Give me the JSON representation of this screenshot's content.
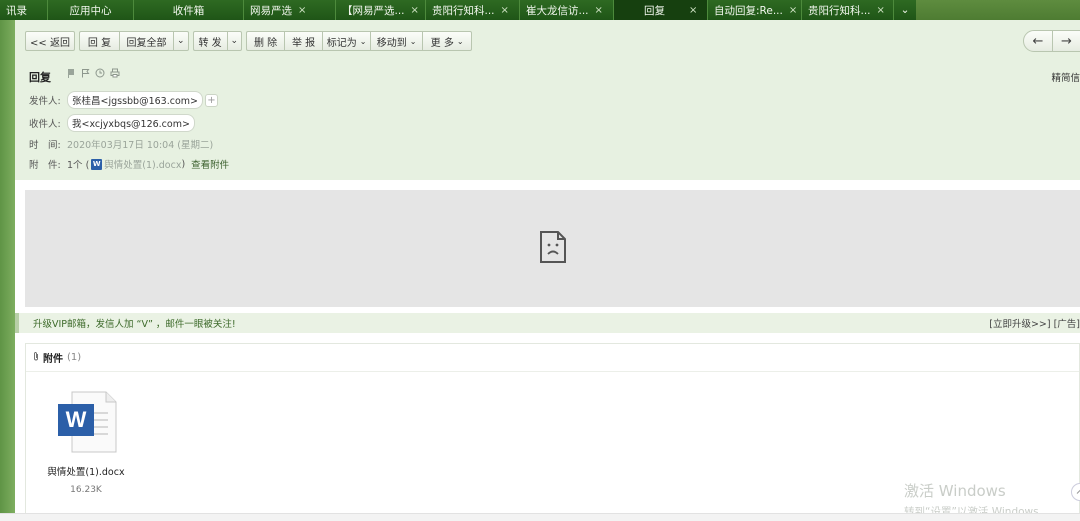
{
  "tabs": [
    {
      "label": "讯录",
      "closable": false
    },
    {
      "label": "应用中心",
      "closable": false
    },
    {
      "label": "收件箱",
      "closable": false
    },
    {
      "label": "网易严选",
      "closable": true
    },
    {
      "label": "【网易严选...",
      "closable": true
    },
    {
      "label": "贵阳行知科...",
      "closable": true
    },
    {
      "label": "崔大龙信访...",
      "closable": true
    },
    {
      "label": "回复",
      "closable": true,
      "active": true
    },
    {
      "label": "自动回复:Re...",
      "closable": true
    },
    {
      "label": "贵阳行知科...",
      "closable": true
    }
  ],
  "tab_close_glyph": "×",
  "tab_more_glyph": "⌄",
  "toolbar": {
    "back": "<< 返回",
    "reply": "回 复",
    "reply_all": "回复全部",
    "forward": "转 发",
    "delete": "删 除",
    "report": "举 报",
    "mark_as": "标记为",
    "move_to": "移动到",
    "more": "更 多",
    "caret": "⌄"
  },
  "nav": {
    "prev": "←",
    "next": "→"
  },
  "mail": {
    "subject": "回复",
    "format_link": "精简信",
    "sender_label": "发件人:",
    "sender": "张桂昌<jgssbb@163.com>",
    "add_glyph": "+",
    "recipient_label": "收件人:",
    "recipient": "我<xcjyxbqs@126.com>",
    "time_label": "时　间:",
    "time": "2020年03月17日 10:04 (星期二)",
    "attach_label": "附　件:",
    "attach_count": "1个 (",
    "attach_file": "舆情处置(1).docx",
    "attach_close": ")",
    "view_attach": "查看附件"
  },
  "ad": {
    "text": "升级VIP邮箱，发信人加 “V” ，邮件一眼被关注!",
    "right": "[立即升级>>] [广告]"
  },
  "attachments": {
    "title": "附件",
    "count": "(1)",
    "files": [
      {
        "name": "舆情处置(1).docx",
        "size": "16.23K",
        "type_letter": "W"
      }
    ]
  },
  "watermark": {
    "line1": "激活 Windows",
    "line2": "转到“设置”以激活 Windows。"
  },
  "colors": {
    "tabbar": "#1f5517",
    "panel": "#e7f1e1",
    "word_blue": "#2b5fa8",
    "ad_text": "#3d6a2a"
  }
}
